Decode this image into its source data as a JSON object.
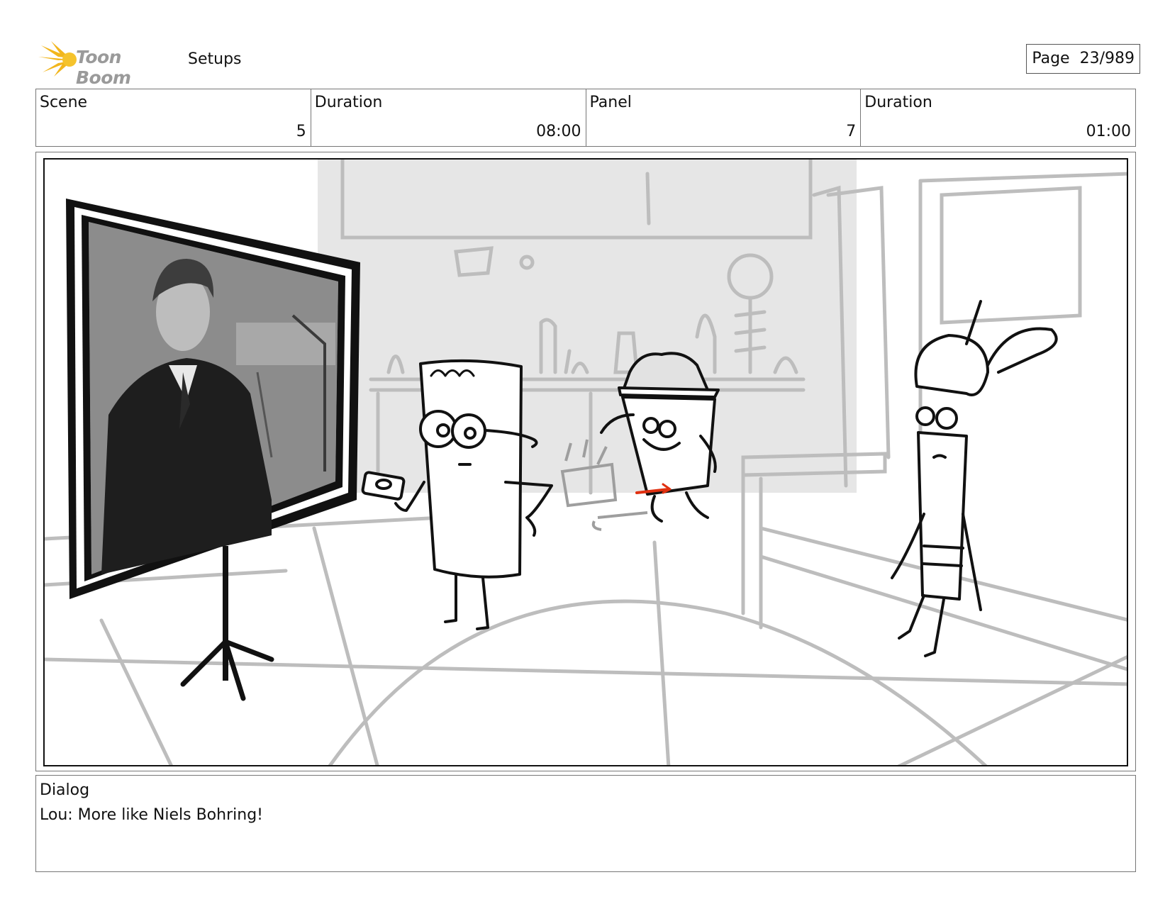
{
  "header": {
    "logo_text": "Toon Boom",
    "project": "Setups",
    "page_label": "Page",
    "page_value": "23/989"
  },
  "info": [
    {
      "label": "Scene",
      "value": "5"
    },
    {
      "label": "Duration",
      "value": "08:00"
    },
    {
      "label": "Panel",
      "value": "7"
    },
    {
      "label": "Duration",
      "value": "01:00"
    }
  ],
  "dialog": {
    "label": "Dialog",
    "text": "Lou: More like Niels Bohring!"
  },
  "colors": {
    "logo_accent": "#f2b61c",
    "sketch_gray": "#bdbdbd",
    "lab_bg": "#e6e6e6",
    "red_arrow": "#e03010"
  }
}
